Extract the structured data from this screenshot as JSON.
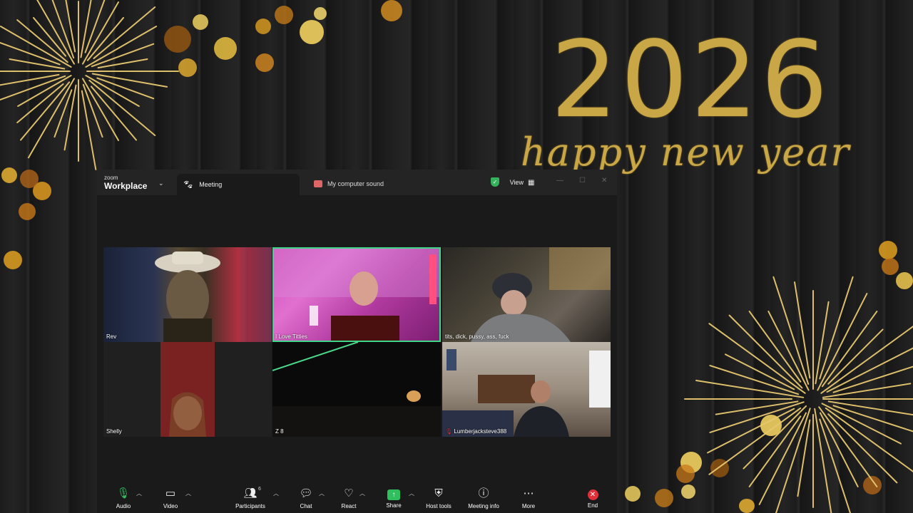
{
  "background": {
    "year": "2026",
    "greeting": "happy new year",
    "accent_color": "#c9a646"
  },
  "titlebar": {
    "brand_small": "zoom",
    "brand_main": "Workplace",
    "meeting_tab": "Meeting",
    "sound_tab": "My computer sound",
    "view_label": "View"
  },
  "tiles": [
    {
      "name": "Rev"
    },
    {
      "name": "I Love Titties"
    },
    {
      "name": "tits, dick, pussy, ass, fuck"
    },
    {
      "name": "Shelly"
    },
    {
      "name": "Z 8"
    },
    {
      "name": "Lumberjacksteve388"
    }
  ],
  "toolbar": {
    "audio": "Audio",
    "video": "Video",
    "participants": "Participants",
    "participants_count": "6",
    "chat": "Chat",
    "react": "React",
    "share": "Share",
    "host_tools": "Host tools",
    "meeting_info": "Meeting info",
    "more": "More",
    "end": "End",
    "end_color": "#e0303a",
    "share_color": "#2fbf5e",
    "active_speaker_color": "#3fd68a"
  }
}
